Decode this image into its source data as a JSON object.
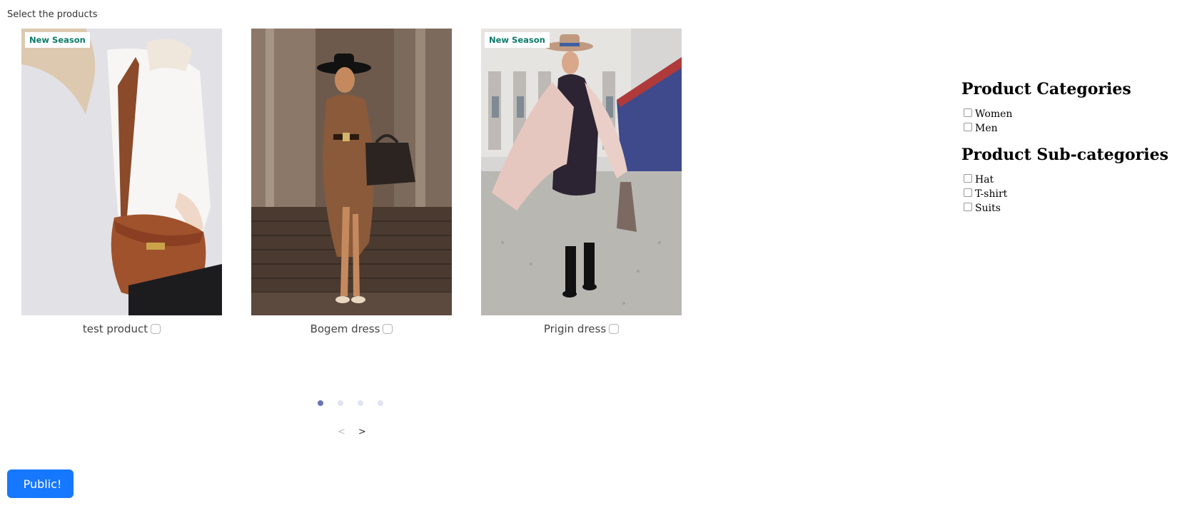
{
  "page": {
    "label": "Select the products"
  },
  "products": [
    {
      "name": "test product",
      "badge": "New Season"
    },
    {
      "name": "Bogem dress",
      "badge": ""
    },
    {
      "name": "Prigin dress",
      "badge": "New Season"
    }
  ],
  "carousel": {
    "dot_count": 4,
    "active_dot": 1,
    "prev_label": "<",
    "next_label": ">"
  },
  "actions": {
    "publish_label": "Public!"
  },
  "filters": {
    "categories_title": "Product Categories",
    "categories": [
      "Women",
      "Men"
    ],
    "subcategories_title": "Product Sub-categories",
    "subcategories": [
      "Hat",
      "T-shirt",
      "Suits"
    ]
  },
  "colors": {
    "primary_button": "#1677ff",
    "badge_text": "#0a7a6a",
    "dot_active": "#6676b8",
    "dot_inactive": "#dfe4f3"
  }
}
